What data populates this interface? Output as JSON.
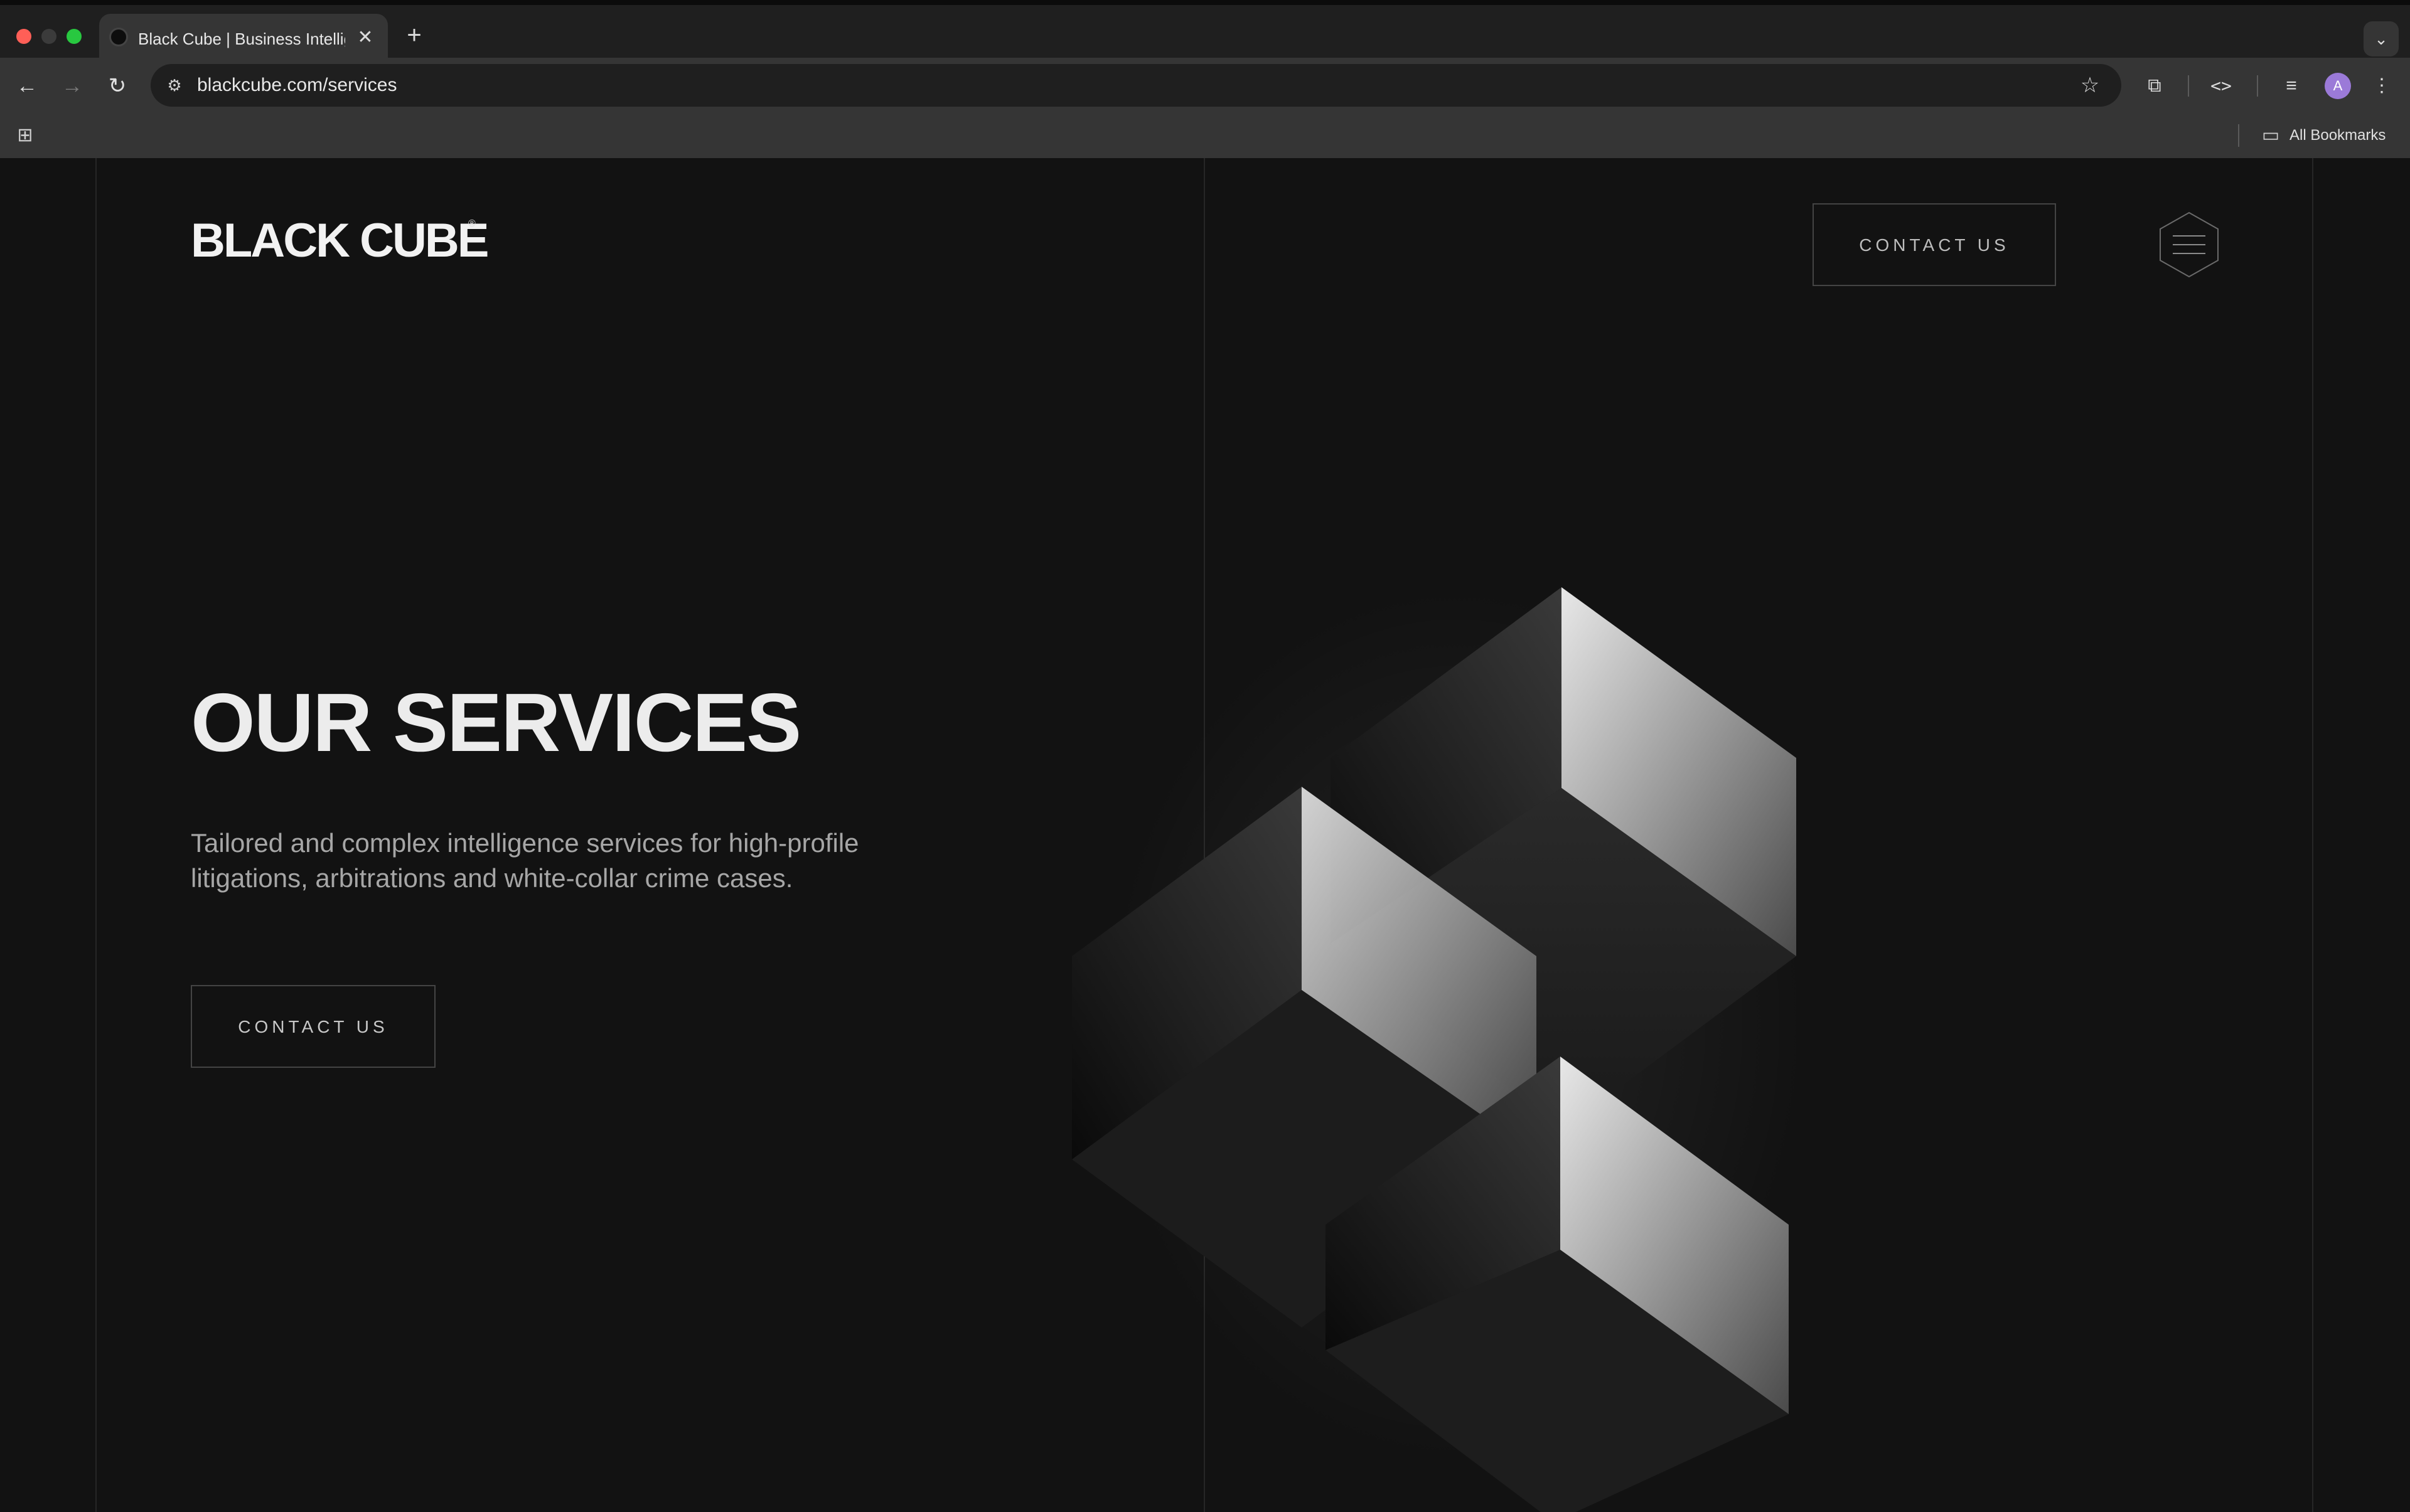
{
  "browser": {
    "tab_title": "Black Cube | Business Intelligence",
    "tab_close": "✕",
    "new_tab": "+",
    "tab_search": "⌄",
    "url": "blackcube.com/services",
    "bookmarks_label": "All Bookmarks",
    "avatar_letter": "A"
  },
  "header": {
    "logo_text": "BLACK CUBE",
    "logo_mark": "®",
    "contact_label": "CONTACT US"
  },
  "hero": {
    "title": "OUR SERVICES",
    "subtitle": "Tailored and complex intelligence services for high-profile litigations, arbitrations and white-collar crime cases.",
    "contact_label": "CONTACT US"
  }
}
